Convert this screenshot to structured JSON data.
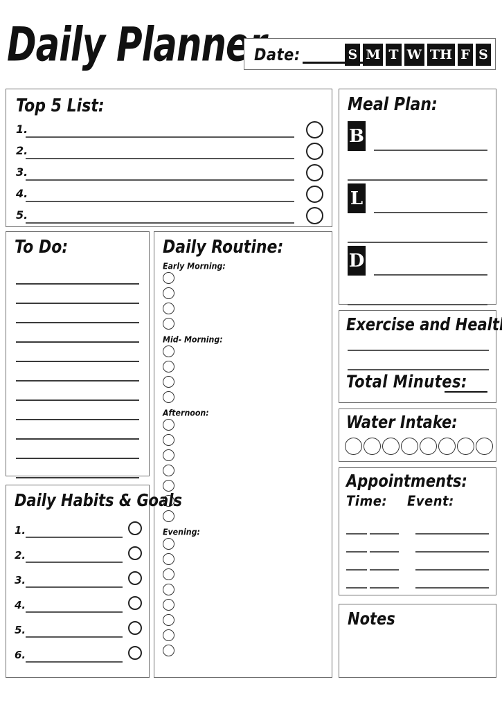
{
  "header": {
    "title": "Daily Planner",
    "date_label": "Date:",
    "days": [
      "S",
      "M",
      "T",
      "W",
      "TH",
      "F",
      "S"
    ]
  },
  "top5": {
    "title": "Top 5 List:",
    "items": [
      "1.",
      "2.",
      "3.",
      "4.",
      "5."
    ]
  },
  "meal_plan": {
    "title": "Meal Plan:",
    "meals": [
      {
        "badge": "B"
      },
      {
        "badge": "L"
      },
      {
        "badge": "D"
      }
    ]
  },
  "todo": {
    "title": "To Do:",
    "line_count": 11
  },
  "routine": {
    "title": "Daily Routine:",
    "groups": [
      {
        "label": "Early Morning:",
        "circles": 4
      },
      {
        "label": "Mid- Morning:",
        "circles": 4
      },
      {
        "label": "Afternoon:",
        "circles": 7
      },
      {
        "label": "Evening:",
        "circles": 8
      }
    ]
  },
  "habits": {
    "title": "Daily Habits & Goals",
    "items": [
      "1.",
      "2.",
      "3.",
      "4.",
      "5.",
      "6."
    ]
  },
  "exercise": {
    "title": "Exercise and Health:",
    "line_count": 2,
    "total_label": "Total Minutes:"
  },
  "water": {
    "title": "Water Intake:",
    "circles": 8
  },
  "appointments": {
    "title": "Appointments:",
    "time_header": "Time:",
    "event_header": "Event:",
    "row_count": 4
  },
  "notes": {
    "title": "Notes"
  },
  "colors": {
    "ink": "#111111",
    "rule": "#555555",
    "border": "#6f6f6f",
    "background": "#ffffff"
  }
}
